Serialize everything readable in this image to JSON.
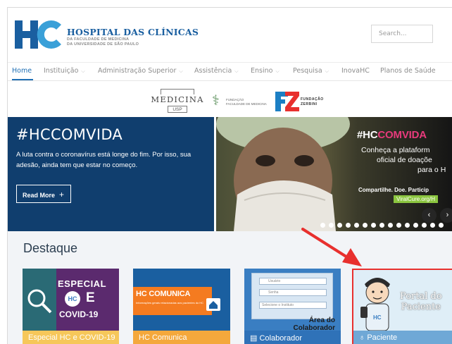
{
  "header": {
    "logo_mark": "HC",
    "logo_title": "HOSPITAL DAS CLÍNICAS",
    "logo_sub1": "DA FACULDADE DE MEDICINA",
    "logo_sub2": "DA UNIVERSIDADE DE SÃO PAULO",
    "search_placeholder": "Search..."
  },
  "nav": {
    "items": [
      {
        "label": "Home"
      },
      {
        "label": "Instituição"
      },
      {
        "label": "Administração Superior"
      },
      {
        "label": "Assistência"
      },
      {
        "label": "Ensino"
      },
      {
        "label": "Pesquisa"
      },
      {
        "label": "InovaHC"
      },
      {
        "label": "Planos de Saúde"
      }
    ],
    "chevron": "⌵"
  },
  "partners": {
    "medicina": "MEDICINA",
    "medicina_usp": "USP",
    "ffm_line1": "FUNDAÇÃO",
    "ffm_line2": "FACULDADE DE MEDICINA",
    "fz_mark": "FZ",
    "fz_line1": "FUNDAÇÃO",
    "fz_line2": "ZERBINI"
  },
  "hero": {
    "title": "#HCCOMVIDA",
    "text": "A luta contra o coronavírus está longe do fim. Por isso, sua adesão, ainda tem que estar no começo.",
    "read_more": "Read More",
    "read_more_plus": "+"
  },
  "slide": {
    "title_prefix": "#HC",
    "title_highlight": "COMVIDA",
    "line1": "Conheça a plataform",
    "line2": "oficial de doaçõe",
    "line3": "para o H",
    "line4": "Compartilhe. Doe. Particip",
    "line5": "ViralCure.org/H",
    "prev": "‹",
    "next": "›"
  },
  "destaque": {
    "title": "Destaque",
    "cards": [
      {
        "label": "Especial HC e COVID-19",
        "especial": "ESPECIAL",
        "hc": "HC",
        "e": "E",
        "covid": "COVID-19"
      },
      {
        "label": "HC Comunica",
        "banner": "HC COMUNICA",
        "banner_sub": "Informações gerais relacionadas aos pacientes do HC"
      },
      {
        "label": "Colaborador",
        "field1": "Usuário",
        "field2": "Senha",
        "field3": "Selecione o Instituto",
        "area_line1": "Área do",
        "area_line2": "Colaborador"
      },
      {
        "label": "Paciente",
        "portal_line1": "Portal do",
        "portal_line2": "Paciente"
      }
    ]
  },
  "colors": {
    "brand_blue": "#1a5fa0",
    "hero_bg": "#103e6e",
    "accent_pink": "#e83a7c",
    "highlight_red": "#e8302e"
  }
}
